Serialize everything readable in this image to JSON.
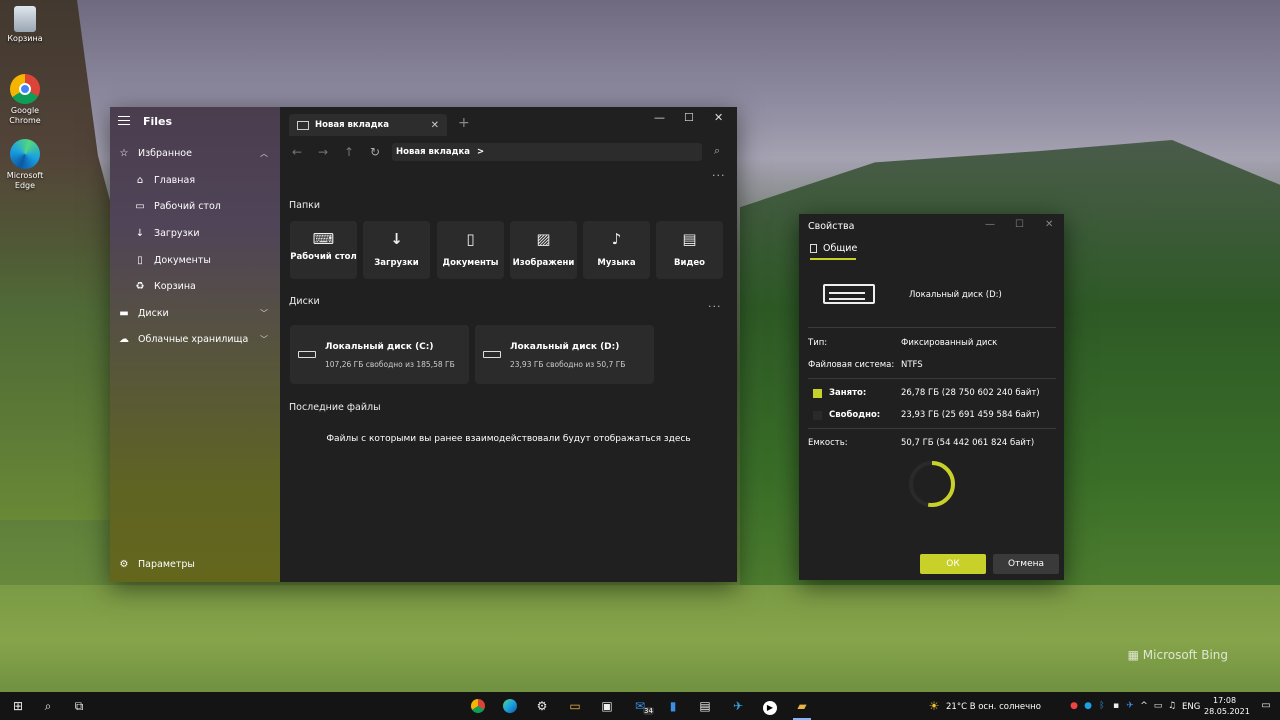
{
  "desktop": {
    "icons": [
      {
        "label": "Корзина",
        "icon": "recycle-bin-icon"
      },
      {
        "label": "Google Chrome",
        "icon": "chrome-icon"
      },
      {
        "label": "Microsoft Edge",
        "icon": "edge-icon"
      }
    ],
    "watermark": "Microsoft Bing"
  },
  "files": {
    "app_title": "Files",
    "sidebar": {
      "favorites_label": "Избранное",
      "items": [
        {
          "label": "Главная",
          "icon": "home-icon"
        },
        {
          "label": "Рабочий стол",
          "icon": "desktop-icon"
        },
        {
          "label": "Загрузки",
          "icon": "download-icon"
        },
        {
          "label": "Документы",
          "icon": "document-icon"
        },
        {
          "label": "Корзина",
          "icon": "recycle-bin-icon"
        }
      ],
      "drives_label": "Диски",
      "cloud_label": "Облачные хранилища",
      "settings_label": "Параметры"
    },
    "tab": {
      "label": "Новая вкладка"
    },
    "address": {
      "crumb": "Новая вкладка",
      "separator": ">"
    },
    "sections": {
      "folders_title": "Папки",
      "drives_title": "Диски",
      "recent_title": "Последние файлы",
      "recent_empty": "Файлы с которыми вы ранее взаимодействовали будут отображаться здесь"
    },
    "folders": [
      {
        "label": "Рабочий стол",
        "icon": "desktop-icon"
      },
      {
        "label": "Загрузки",
        "icon": "download-icon"
      },
      {
        "label": "Документы",
        "icon": "document-icon"
      },
      {
        "label": "Изображени",
        "icon": "image-icon"
      },
      {
        "label": "Музыка",
        "icon": "music-icon"
      },
      {
        "label": "Видео",
        "icon": "video-icon"
      }
    ],
    "drives": [
      {
        "name": "Локальный диск (C:)",
        "free": "107,26 ГБ свободно из 185,58 ГБ"
      },
      {
        "name": "Локальный диск (D:)",
        "free": "23,93 ГБ свободно из 50,7 ГБ"
      }
    ]
  },
  "properties": {
    "title": "Свойства",
    "tab_label": "Общие",
    "drive_name": "Локальный диск (D:)",
    "type_label": "Тип:",
    "type_value": "Фиксированный диск",
    "fs_label": "Файловая система:",
    "fs_value": "NTFS",
    "used_label": "Занято:",
    "used_value": "26,78 ГБ (28 750 602 240 байт)",
    "free_label": "Свободно:",
    "free_value": "23,93 ГБ (25 691 459 584 байт)",
    "capacity_label": "Емкость:",
    "capacity_value": "50,7 ГБ (54 442 061 824 байт)",
    "used_fraction": 0.528,
    "ok_label": "ОК",
    "cancel_label": "Отмена",
    "colors": {
      "accent": "#c7d12a",
      "free": "#2a2a2a"
    }
  },
  "taskbar": {
    "weather": "21°C  В осн. солнечно",
    "lang": "ENG",
    "time": "17:08",
    "date": "28.05.2021",
    "mail_badge": "34"
  }
}
